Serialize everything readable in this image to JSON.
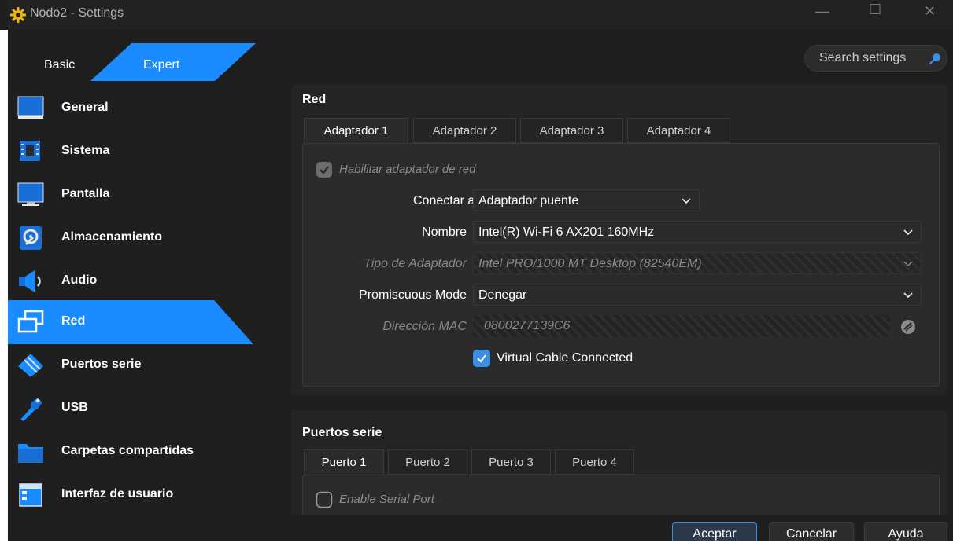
{
  "window": {
    "title": "Nodo2  - Settings"
  },
  "mode": {
    "basic_label": "Basic",
    "expert_label": "Expert"
  },
  "search": {
    "placeholder": "Search settings"
  },
  "sidebar": {
    "items": [
      {
        "label": "General",
        "icon": "monitor-icon"
      },
      {
        "label": "Sistema",
        "icon": "chip-icon"
      },
      {
        "label": "Pantalla",
        "icon": "display-icon"
      },
      {
        "label": "Almacenamiento",
        "icon": "storage-icon"
      },
      {
        "label": "Audio",
        "icon": "speaker-icon"
      },
      {
        "label": "Red",
        "icon": "network-icon",
        "active": true
      },
      {
        "label": "Puertos serie",
        "icon": "serial-port-icon"
      },
      {
        "label": "USB",
        "icon": "usb-icon"
      },
      {
        "label": "Carpetas compartidas",
        "icon": "folder-icon"
      },
      {
        "label": "Interfaz de usuario",
        "icon": "window-icon"
      }
    ]
  },
  "network": {
    "title": "Red",
    "tabs": [
      "Adaptador 1",
      "Adaptador 2",
      "Adaptador 3",
      "Adaptador 4"
    ],
    "enable_label": "Habilitar adaptador de red",
    "attach_label": "Conectar a",
    "attach_value": "Adaptador puente",
    "name_label": "Nombre",
    "name_value": "Intel(R) Wi-Fi 6 AX201 160MHz",
    "adapter_type_label": "Tipo de Adaptador",
    "adapter_type_value": "Intel PRO/1000 MT Desktop (82540EM)",
    "promisc_label": "Promiscuous Mode",
    "promisc_value": "Denegar",
    "mac_label": "Dirección MAC",
    "mac_value": "0800277139C6",
    "cable_label": "Virtual Cable Connected"
  },
  "serial": {
    "title": "Puertos serie",
    "tabs": [
      "Puerto 1",
      "Puerto 2",
      "Puerto 3",
      "Puerto 4"
    ],
    "enable_label": "Enable Serial Port"
  },
  "buttons": {
    "ok": "Aceptar",
    "cancel": "Cancelar",
    "help": "Ayuda"
  },
  "colors": {
    "accent": "#1a8cff",
    "background": "#1f1f1f",
    "panel": "#242424"
  }
}
